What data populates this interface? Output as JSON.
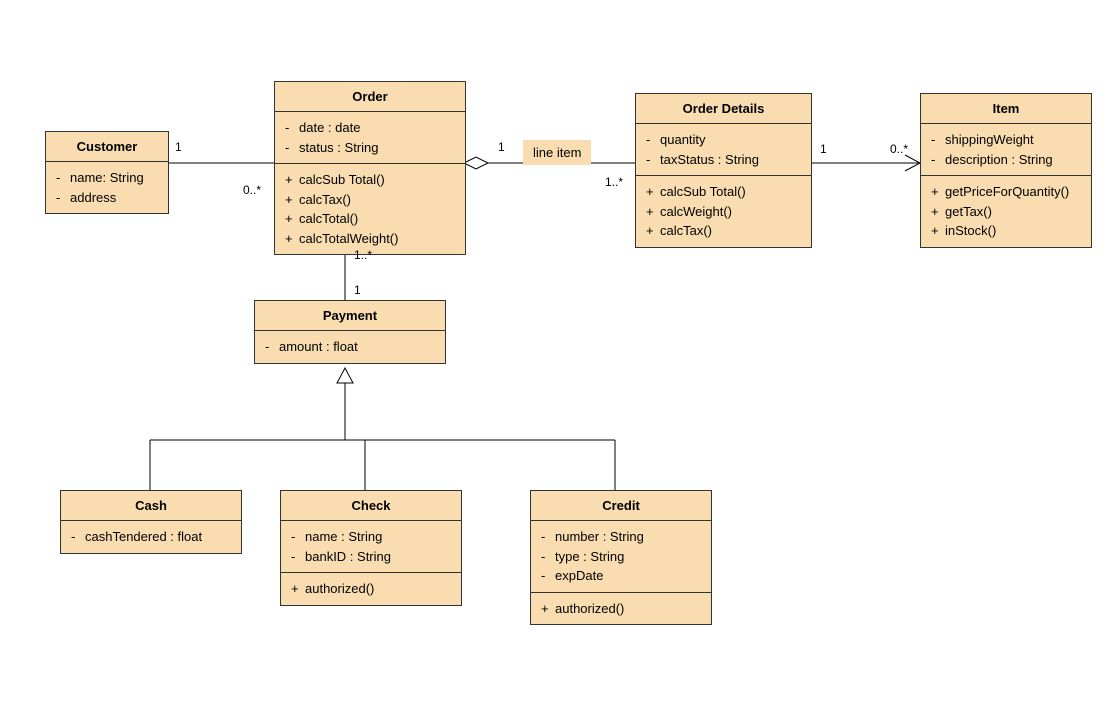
{
  "classes": {
    "customer": {
      "name": "Customer",
      "attrs": [
        {
          "vis": "-",
          "text": "name: String"
        },
        {
          "vis": "-",
          "text": "address"
        }
      ]
    },
    "order": {
      "name": "Order",
      "attrs": [
        {
          "vis": "-",
          "text": "date : date"
        },
        {
          "vis": "-",
          "text": "status : String"
        }
      ],
      "ops": [
        {
          "vis": "+",
          "text": "calcSub Total()"
        },
        {
          "vis": "+",
          "text": "calcTax()"
        },
        {
          "vis": "+",
          "text": "calcTotal()"
        },
        {
          "vis": "+",
          "text": "calcTotalWeight()"
        }
      ]
    },
    "orderDetails": {
      "name": "Order Details",
      "attrs": [
        {
          "vis": "-",
          "text": "quantity"
        },
        {
          "vis": "-",
          "text": "taxStatus : String"
        }
      ],
      "ops": [
        {
          "vis": "+",
          "text": "calcSub Total()"
        },
        {
          "vis": "+",
          "text": "calcWeight()"
        },
        {
          "vis": "+",
          "text": "calcTax()"
        }
      ]
    },
    "item": {
      "name": "Item",
      "attrs": [
        {
          "vis": "-",
          "text": "shippingWeight"
        },
        {
          "vis": "-",
          "text": "description : String"
        }
      ],
      "ops": [
        {
          "vis": "+",
          "text": "getPriceForQuantity()"
        },
        {
          "vis": "+",
          "text": "getTax()"
        },
        {
          "vis": "+",
          "text": "inStock()"
        }
      ]
    },
    "payment": {
      "name": "Payment",
      "attrs": [
        {
          "vis": "-",
          "text": "amount : float"
        }
      ]
    },
    "cash": {
      "name": "Cash",
      "attrs": [
        {
          "vis": "-",
          "text": "cashTendered : float"
        }
      ]
    },
    "check": {
      "name": "Check",
      "attrs": [
        {
          "vis": "-",
          "text": "name : String"
        },
        {
          "vis": "-",
          "text": "bankID : String"
        }
      ],
      "ops": [
        {
          "vis": "+",
          "text": "authorized()"
        }
      ]
    },
    "credit": {
      "name": "Credit",
      "attrs": [
        {
          "vis": "-",
          "text": "number : String"
        },
        {
          "vis": "-",
          "text": "type : String"
        },
        {
          "vis": "-",
          "text": "expDate"
        }
      ],
      "ops": [
        {
          "vis": "+",
          "text": "authorized()"
        }
      ]
    }
  },
  "labels": {
    "lineItem": "line item"
  },
  "multiplicities": {
    "cust_order_cust": "1",
    "cust_order_order": "0..*",
    "order_details_order": "1",
    "order_details_details": "1..*",
    "details_item_details": "1",
    "details_item_item": "0..*",
    "order_payment_order": "1..*",
    "order_payment_payment": "1"
  }
}
